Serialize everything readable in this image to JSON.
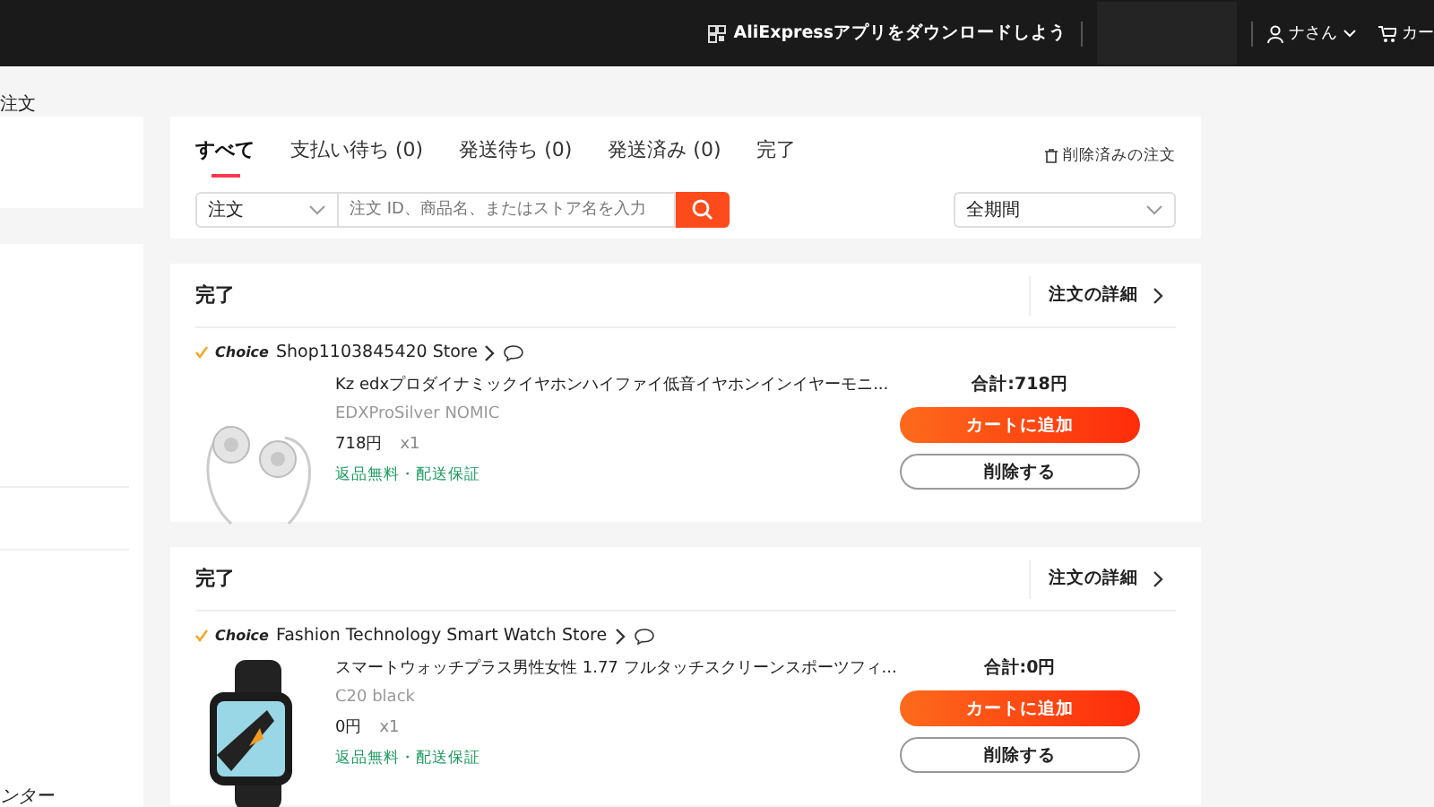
{
  "header": {
    "app_download": "AliExpressアプリをダウンロードしよう",
    "account": "ナさん",
    "cart": "カー"
  },
  "breadcrumb": "注文",
  "sidebar": {
    "items": [
      "ンター"
    ]
  },
  "tabs": [
    {
      "label": "すべて",
      "selected": true
    },
    {
      "label": "支払い待ち (0)",
      "selected": false
    },
    {
      "label": "発送待ち (0)",
      "selected": false
    },
    {
      "label": "発送済み (0)",
      "selected": false
    },
    {
      "label": "完了",
      "selected": false
    }
  ],
  "deleted_orders": "削除済みの注文",
  "filter": {
    "type": "注文",
    "placeholder": "注文 ID、商品名、またはストア名を入力",
    "period": "全期間"
  },
  "orders": [
    {
      "status": "完了",
      "details_link": "注文の詳細",
      "badge": "Choice",
      "store": "Shop1103845420 Store",
      "product": {
        "kind": "earphones",
        "title": "Kz edxプロダイナミックイヤホンハイファイ低音イヤホンインイヤーモニ...",
        "variant": "EDXProSilver NOMIC",
        "price": "718円",
        "quantity": "x1",
        "guarantee": "返品無料・配送保証"
      },
      "total": "合計:718円",
      "add_to_cart": "カートに追加",
      "delete": "削除する"
    },
    {
      "status": "完了",
      "details_link": "注文の詳細",
      "badge": "Choice",
      "store": "Fashion Technology Smart Watch Store",
      "product": {
        "kind": "watch",
        "title": "スマートウォッチプラス男性女性 1.77 フルタッチスクリーンスポーツフィ...",
        "variant": "C20 black",
        "price": "0円",
        "quantity": "x1",
        "guarantee": "返品無料・配送保証"
      },
      "total": "合計:0円",
      "add_to_cart": "カートに追加",
      "delete": "削除する"
    }
  ]
}
